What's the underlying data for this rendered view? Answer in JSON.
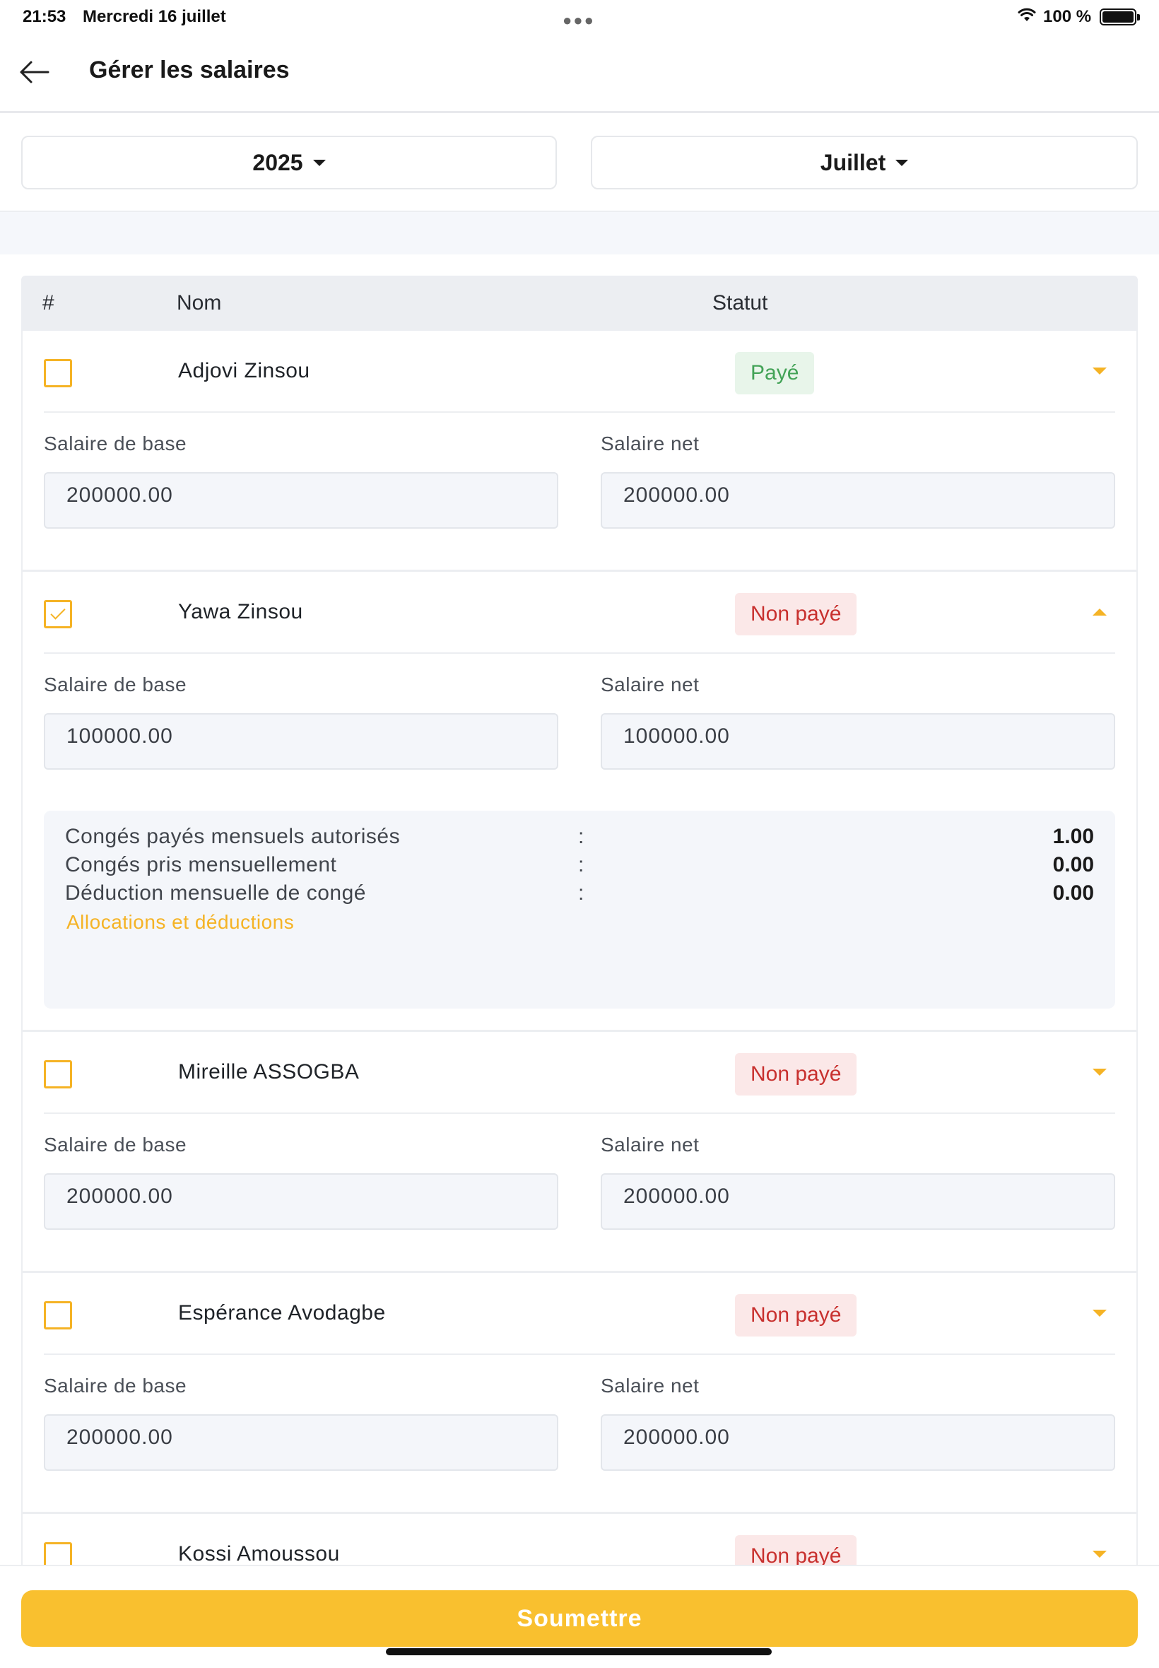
{
  "status_bar": {
    "time": "21:53",
    "date": "Mercredi 16 juillet",
    "battery_label": "100 %",
    "wifi_icon": "wifi-icon",
    "battery_icon": "battery-icon"
  },
  "header": {
    "title": "Gérer les salaires",
    "back_icon": "arrow-left-icon"
  },
  "filters": {
    "year": "2025",
    "month": "Juillet"
  },
  "table": {
    "headers": {
      "num": "#",
      "name": "Nom",
      "status": "Statut"
    },
    "base_label": "Salaire de base",
    "net_label": "Salaire net",
    "rows": [
      {
        "name": "Adjovi Zinsou",
        "status": "Payé",
        "checked": false,
        "expanded": false,
        "base": "200000.00",
        "net": "200000.00"
      },
      {
        "name": "Yawa Zinsou",
        "status": "Non payé",
        "checked": true,
        "expanded": true,
        "base": "100000.00",
        "net": "100000.00",
        "details": {
          "lines": [
            {
              "label": "Congés payés mensuels autorisés",
              "sep": ":",
              "value": "1.00"
            },
            {
              "label": "Congés pris mensuellement",
              "sep": ":",
              "value": "0.00"
            },
            {
              "label": "Déduction mensuelle de congé",
              "sep": ":",
              "value": "0.00"
            }
          ],
          "link": "Allocations et déductions"
        }
      },
      {
        "name": "Mireille ASSOGBA",
        "status": "Non payé",
        "checked": false,
        "expanded": false,
        "base": "200000.00",
        "net": "200000.00"
      },
      {
        "name": "Espérance Avodagbe",
        "status": "Non payé",
        "checked": false,
        "expanded": false,
        "base": "200000.00",
        "net": "200000.00"
      },
      {
        "name": "Kossi Amoussou",
        "status": "Non payé",
        "checked": false,
        "expanded": false
      }
    ]
  },
  "footer": {
    "submit_label": "Soumettre"
  },
  "colors": {
    "accent": "#f9c02f",
    "paid_bg": "#e8f5ea",
    "paid_text": "#43a357",
    "unpaid_bg": "#fbe8e8",
    "unpaid_text": "#c8302e"
  }
}
